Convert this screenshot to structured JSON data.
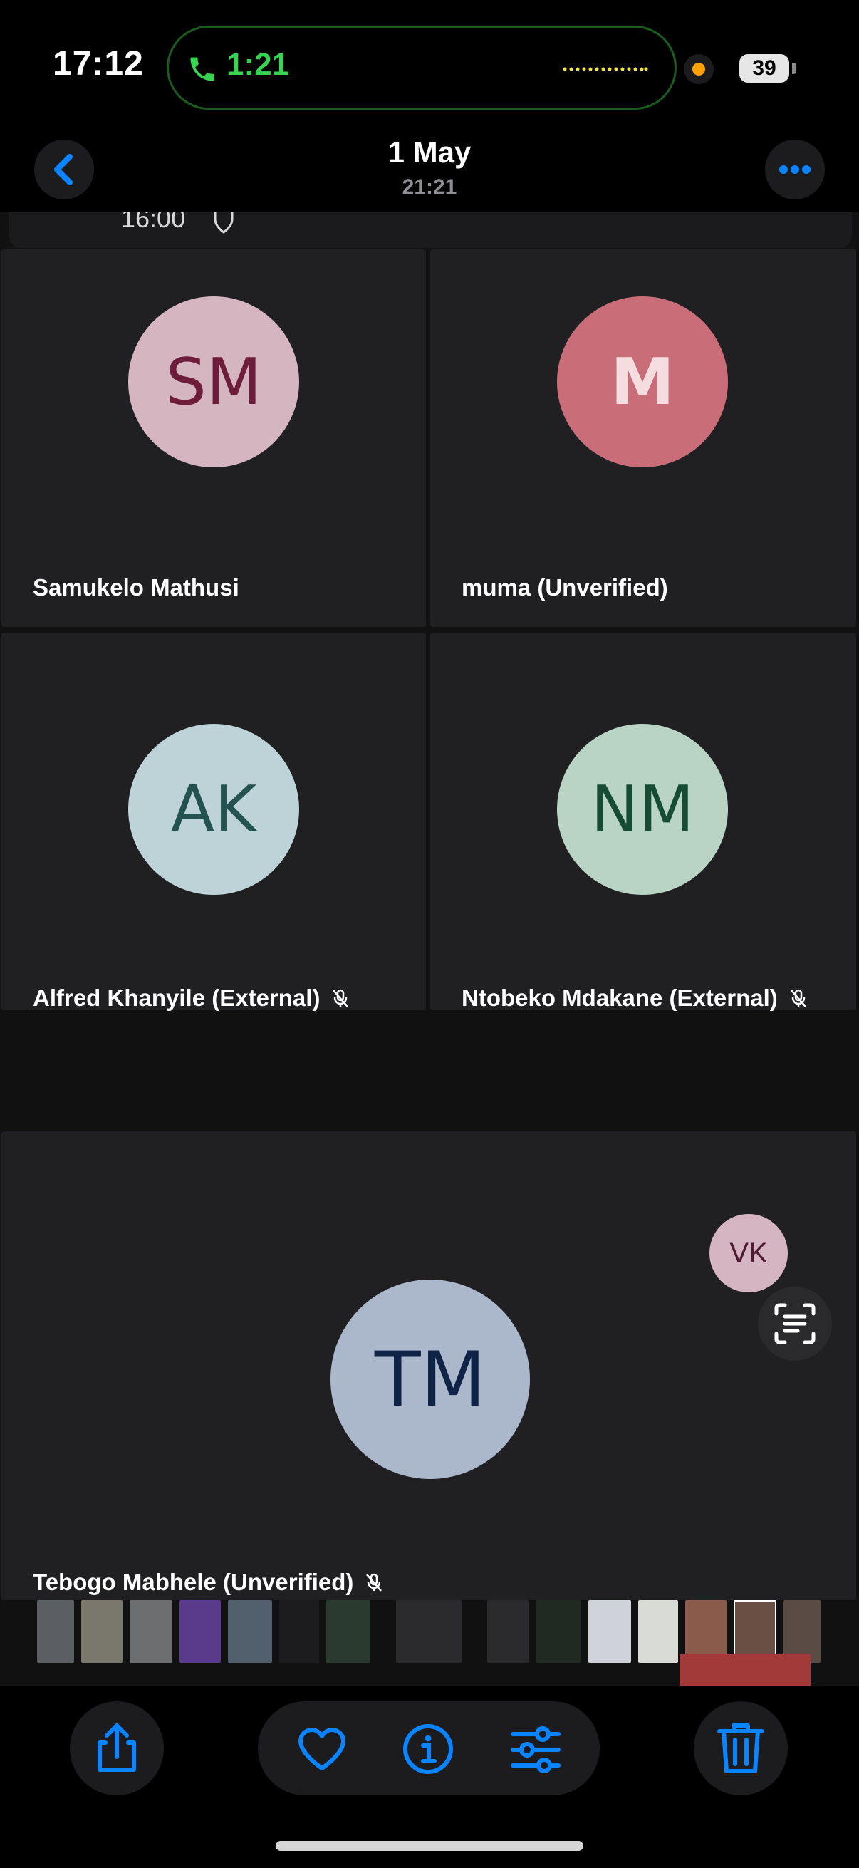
{
  "status_bar": {
    "time": "17:12",
    "call_duration": "1:21",
    "battery": "39"
  },
  "header": {
    "date": "1 May",
    "time": "21:21"
  },
  "photo": {
    "cut_time": "16:00",
    "participants": [
      {
        "initials": "SM",
        "name": "Samukelo Mathusi",
        "avatar_bg": "#d4b5c0",
        "avatar_fg": "#6d1d3a",
        "muted": false
      },
      {
        "initials": "M",
        "name": "muma (Unverified)",
        "avatar_bg": "#c96e78",
        "avatar_fg": "#f4dcdf",
        "muted": false
      },
      {
        "initials": "AK",
        "name": "Alfred Khanyile (External)",
        "avatar_bg": "#bdd3d7",
        "avatar_fg": "#245250",
        "muted": true
      },
      {
        "initials": "NM",
        "name": "Ntobeko Mdakane (External)",
        "avatar_bg": "#b9d4c5",
        "avatar_fg": "#164c34",
        "muted": true
      },
      {
        "initials": "TM",
        "name": "Tebogo Mabhele (Unverified)",
        "avatar_bg": "#abb8cc",
        "avatar_fg": "#0f2347",
        "muted": true
      }
    ],
    "floating_avatar": {
      "initials": "VK"
    }
  },
  "colors": {
    "accent": "#0a84ff",
    "call_green": "#39d353"
  },
  "toolbar": {
    "share_icon": "share-icon",
    "favorite_icon": "heart-icon",
    "info_icon": "info-icon",
    "adjust_icon": "sliders-icon",
    "delete_icon": "trash-icon"
  }
}
